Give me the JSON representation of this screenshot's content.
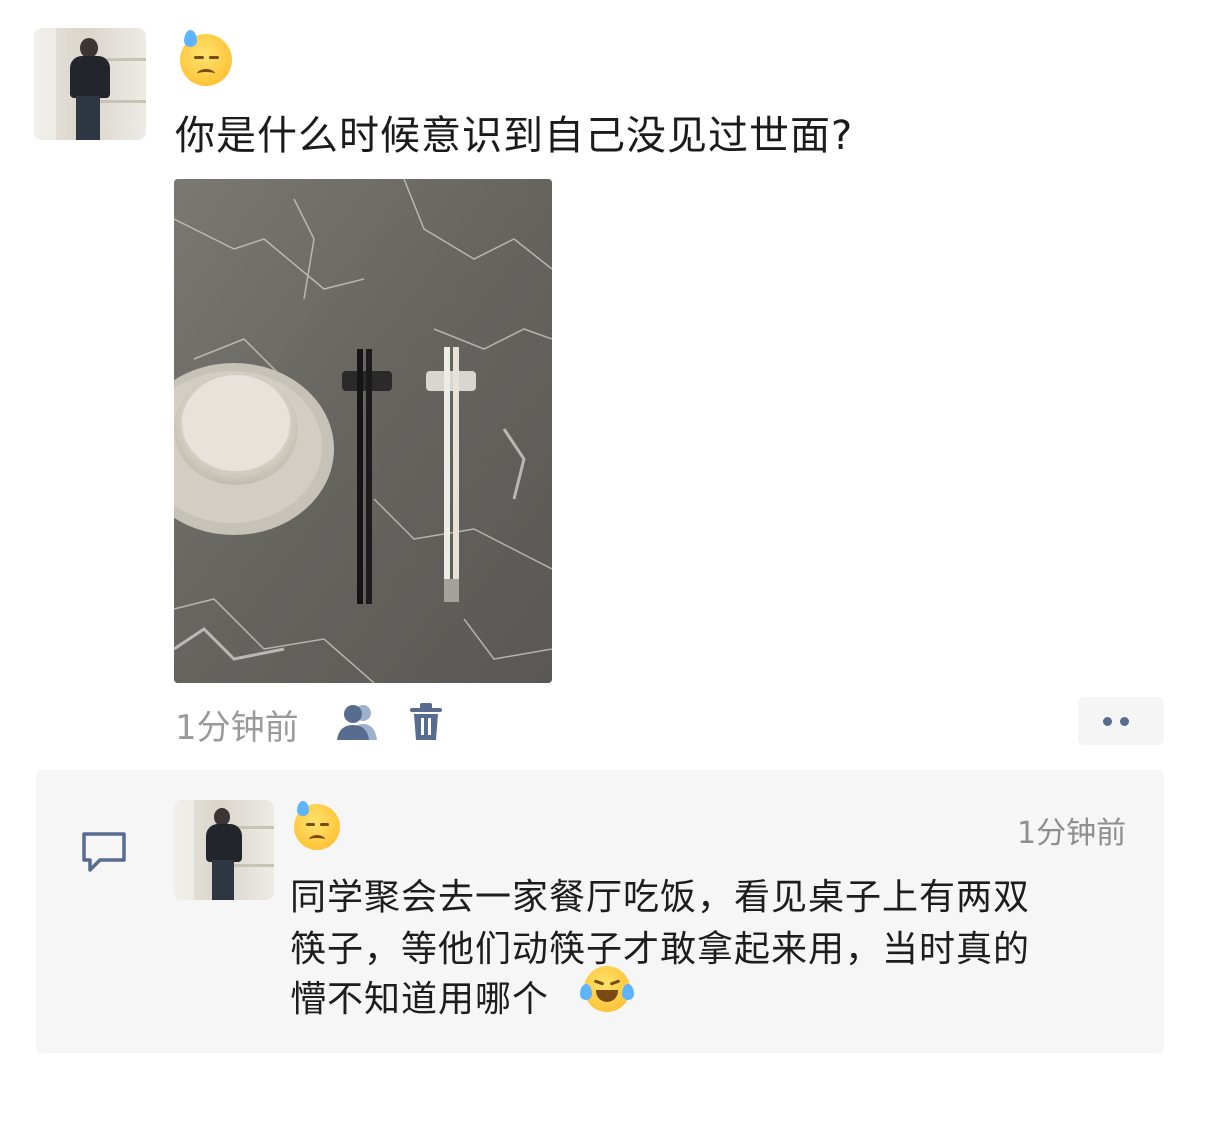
{
  "post": {
    "title": "你是什么时候意识到自己没见过世面?",
    "time": "1分钟前"
  },
  "comment": {
    "time": "1分钟前",
    "lines": [
      "同学聚会去一家餐厅吃饭，看见桌子上有两双",
      "筷子，等他们动筷子才敢拿起来用，当时真的",
      "懵不知道用哪个"
    ]
  },
  "icons": {
    "status_emoji": "anxious-sweat-emoji",
    "comment_end_emoji": "crying-laughing-emoji",
    "people": "people-icon",
    "trash": "trash-icon",
    "more": "more-dots-icon",
    "comment": "comment-bubble-icon"
  },
  "colors": {
    "link_blue": "#586c90",
    "muted_text": "#9a9a9a",
    "panel_bg": "#f6f6f6"
  }
}
